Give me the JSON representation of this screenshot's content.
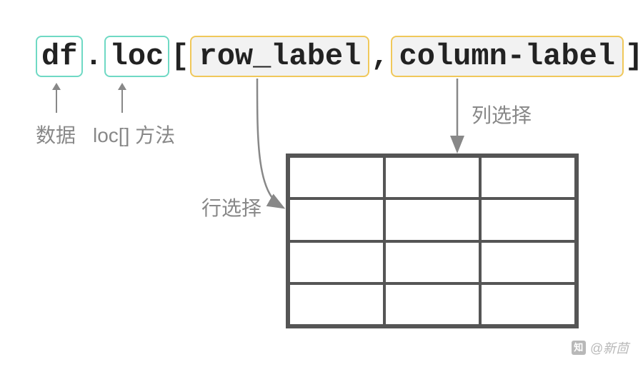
{
  "code": {
    "df": "df",
    "dot": ".",
    "loc": "loc",
    "bracket_open": "[",
    "row_label": "row_label",
    "comma": ",",
    "column_label": "column-label",
    "bracket_close": "]"
  },
  "annotations": {
    "data_label": "数据",
    "loc_method_label": "loc[] 方法",
    "row_select": "行选择",
    "col_select": "列选择"
  },
  "watermark": {
    "icon": "知",
    "text": "@新茴"
  }
}
